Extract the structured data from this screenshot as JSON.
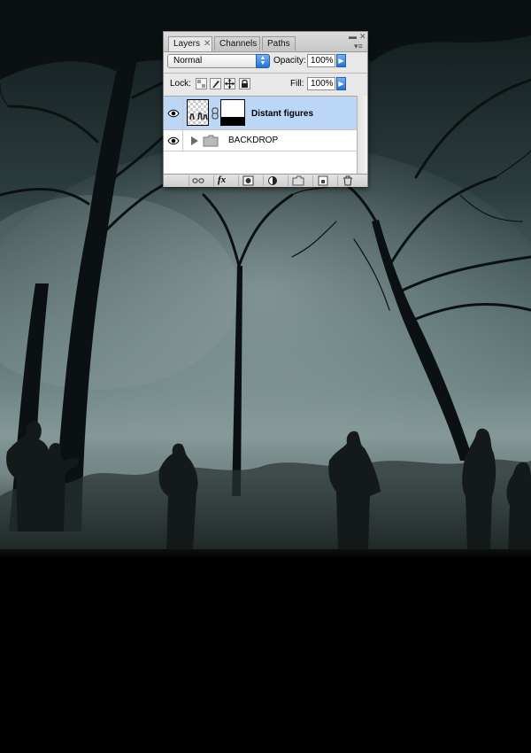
{
  "panel": {
    "tabs": [
      {
        "label": "Layers",
        "active": true
      },
      {
        "label": "Channels",
        "active": false
      },
      {
        "label": "Paths",
        "active": false
      }
    ],
    "blend_mode": "Normal",
    "opacity_label": "Opacity:",
    "opacity_value": "100%",
    "lock_label": "Lock:",
    "fill_label": "Fill:",
    "fill_value": "100%",
    "layers": [
      {
        "name": "Distant figures",
        "selected": true,
        "visible": true,
        "has_mask": true
      },
      {
        "name": "BACKDROP",
        "selected": false,
        "visible": true,
        "is_group": true,
        "collapsed": true
      }
    ],
    "selection_color": "#bcd6f6"
  },
  "artwork": {
    "sky_color": "#2c3d3f",
    "fog_color": "#9aacab",
    "ground_color": "#000000"
  }
}
